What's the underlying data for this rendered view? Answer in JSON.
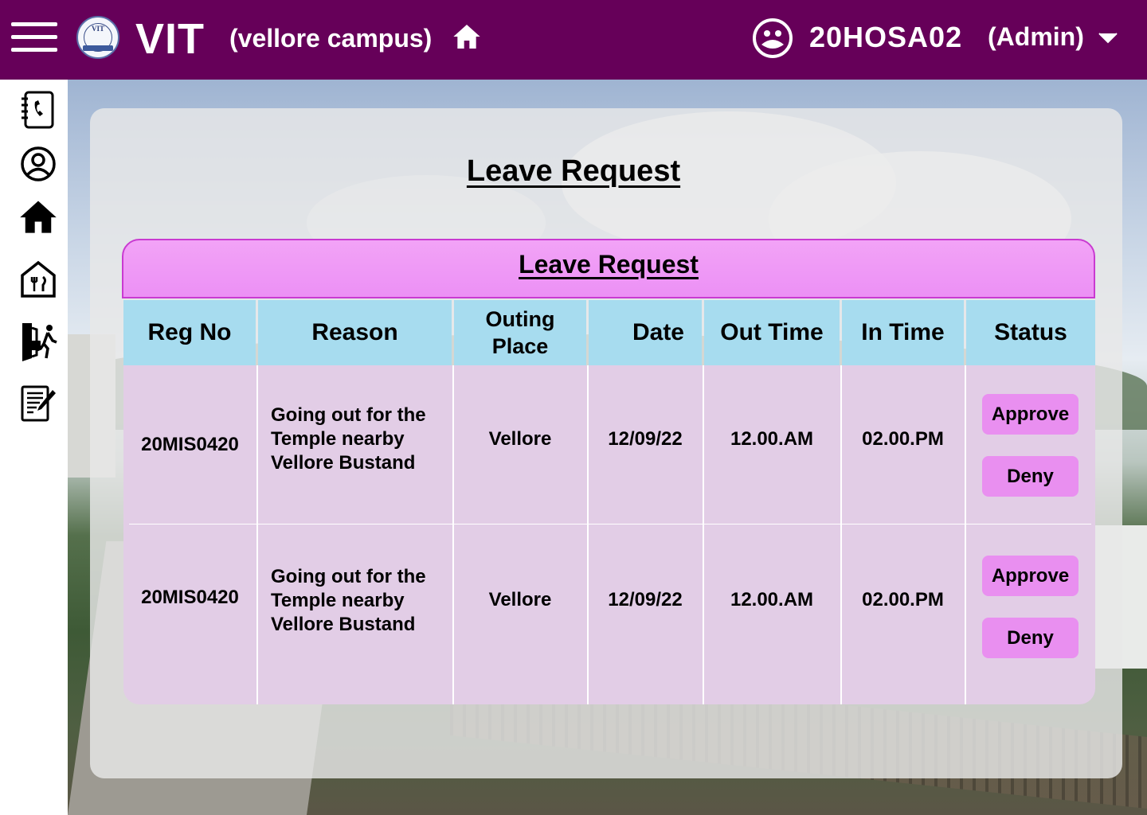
{
  "header": {
    "brand": "VIT",
    "campus": "(vellore campus)",
    "user_id": "20HOSA02",
    "role": "(Admin)",
    "logo_text": "VIT",
    "bg_color": "#660059"
  },
  "sidebar": {
    "items": [
      {
        "icon": "contacts-book-icon"
      },
      {
        "icon": "profile-icon"
      },
      {
        "icon": "home-icon"
      },
      {
        "icon": "mess-icon"
      },
      {
        "icon": "leave-exit-icon"
      },
      {
        "icon": "form-edit-icon"
      }
    ]
  },
  "page": {
    "title": "Leave Request"
  },
  "table": {
    "caption": "Leave Request",
    "columns": [
      "Reg No",
      "Reason",
      "Outing Place",
      "Date",
      "Out Time",
      "In Time",
      "Status"
    ],
    "rows": [
      {
        "reg_no": "20MIS0420",
        "reason": "Going out for the Temple nearby Vellore Bustand",
        "place": "Vellore",
        "date": "12/09/22",
        "out_time": "12.00.AM",
        "in_time": "02.00.PM",
        "approve_label": "Approve",
        "deny_label": "Deny"
      },
      {
        "reg_no": "20MIS0420",
        "reason": "Going out for the Temple nearby Vellore Bustand",
        "place": "Vellore",
        "date": "12/09/22",
        "out_time": "12.00.AM",
        "in_time": "02.00.PM",
        "approve_label": "Approve",
        "deny_label": "Deny"
      }
    ]
  },
  "colors": {
    "header_bg": "#660059",
    "table_header": "#a7dcef",
    "row_bg": "#e2cde6",
    "caption_bg": "#ec90f5",
    "button_bg": "#e98ff0"
  }
}
